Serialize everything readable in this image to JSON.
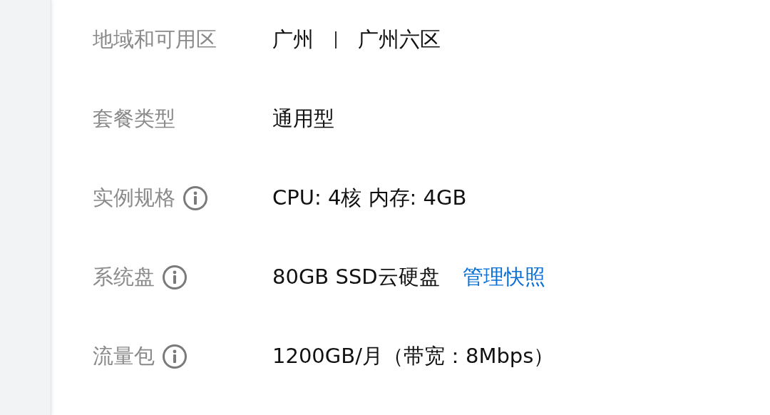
{
  "rows": [
    {
      "label": "地域和可用区",
      "info": false,
      "kind": "region",
      "parts": [
        "广州",
        "广州六区"
      ]
    },
    {
      "label": "套餐类型",
      "info": false,
      "kind": "text",
      "value": "通用型"
    },
    {
      "label": "实例规格",
      "info": true,
      "kind": "text",
      "value": "CPU: 4核 内存: 4GB"
    },
    {
      "label": "系统盘",
      "info": true,
      "kind": "text",
      "value": "80GB SSD云硬盘",
      "link": "管理快照"
    },
    {
      "label": "流量包",
      "info": true,
      "kind": "text",
      "value": "1200GB/月（带宽：8Mbps）"
    }
  ]
}
